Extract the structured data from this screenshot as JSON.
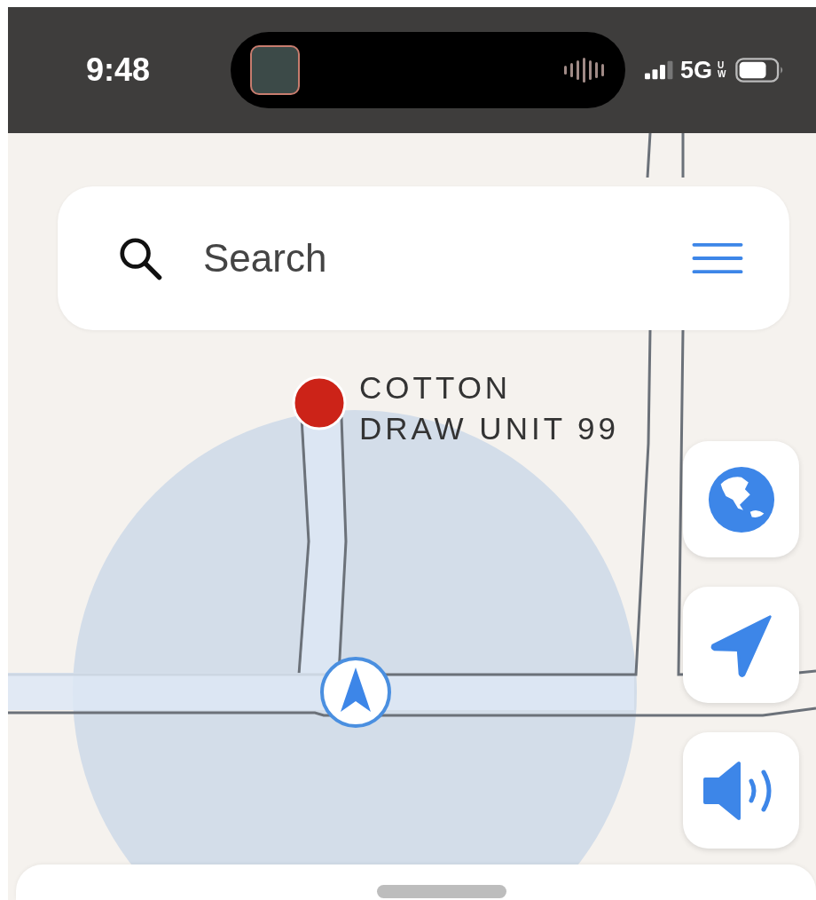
{
  "status_bar": {
    "time": "9:48",
    "network": "5G",
    "network_sub": "UW"
  },
  "search": {
    "placeholder": "Search"
  },
  "map": {
    "place_label": "COTTON DRAW UNIT 99"
  },
  "map_buttons": [
    {
      "kind": "globe"
    },
    {
      "kind": "locate"
    },
    {
      "kind": "sound"
    }
  ]
}
